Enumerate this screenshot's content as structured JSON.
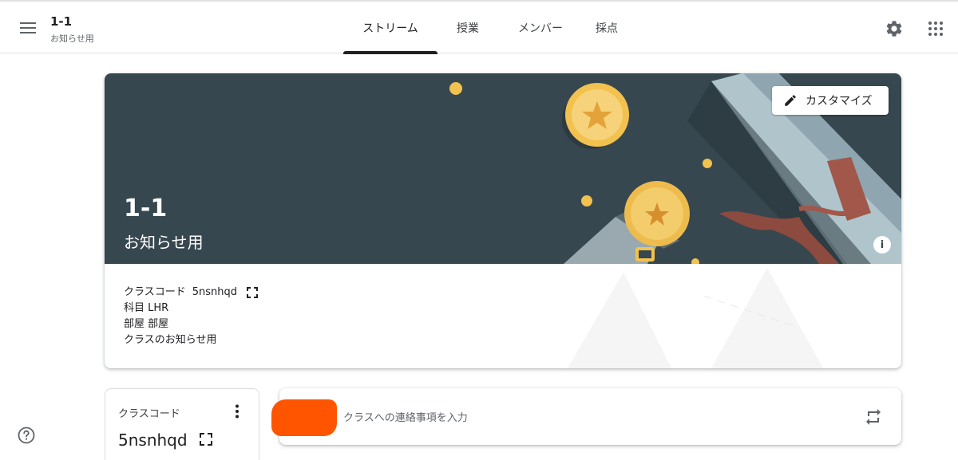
{
  "header": {
    "class_title": "1-1",
    "class_subtitle": "お知らせ用",
    "tabs": [
      {
        "label": "ストリーム",
        "active": true
      },
      {
        "label": "授業",
        "active": false
      },
      {
        "label": "メンバー",
        "active": false
      },
      {
        "label": "採点",
        "active": false
      }
    ],
    "icons": [
      "menu-icon",
      "settings-icon",
      "apps-grid-icon"
    ]
  },
  "banner": {
    "title": "1-1",
    "subtitle": "お知らせ用",
    "customize_label": "カスタマイズ",
    "info_glyph": "i",
    "background_color": "#37474f"
  },
  "details": {
    "class_code_label": "クラスコード",
    "class_code": "5nsnhqd",
    "subject": "科目 LHR",
    "room": "部屋 部屋",
    "description": "クラスのお知らせ用"
  },
  "code_card": {
    "title": "クラスコード",
    "value": "5nsnhqd"
  },
  "announce": {
    "placeholder": "クラスへの連絡事項を入力",
    "redaction_color": "#ff5500"
  }
}
